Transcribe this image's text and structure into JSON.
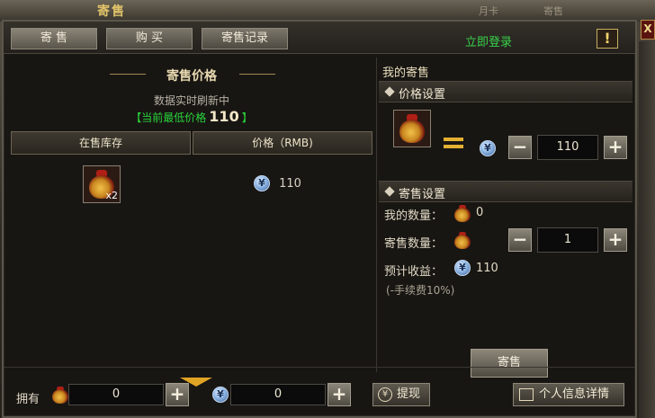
{
  "scene": {
    "title": "寄售",
    "bg_text_left": "月卡",
    "bg_text_right": "寄售"
  },
  "tabs": [
    {
      "label": "寄 售"
    },
    {
      "label": "购 买"
    },
    {
      "label": "寄售记录"
    }
  ],
  "header": {
    "login_link": "立即登录",
    "alert_icon": "!",
    "close_icon": "X"
  },
  "left": {
    "section_title": "寄售价格",
    "refresh_text": "数据实时刷新中",
    "lowest_prefix": "【当前最低价格",
    "lowest_value": "110",
    "lowest_suffix": "】",
    "columns": [
      "在售库存",
      "价格（RMB)"
    ],
    "rows": [
      {
        "item_icon": "lucky-bag-icon",
        "quantity": "x2",
        "price": "110"
      }
    ]
  },
  "right": {
    "title": "我的寄售",
    "price_settings": {
      "heading": "价格设置",
      "equals": "=",
      "value": "110",
      "minus": "−",
      "plus": "+"
    },
    "sale_settings": {
      "heading": "寄售设置",
      "my_quantity_label": "我的数量：",
      "my_quantity_value": "0",
      "sell_quantity_label": "寄售数量：",
      "sell_quantity_value": "1",
      "minus": "−",
      "plus": "+",
      "expected_label": "预计收益：",
      "expected_value": "110",
      "fee_note": "(-手续费10%)"
    },
    "sell_button": "寄售"
  },
  "bottom": {
    "own_label": "拥有",
    "bag_count": "0",
    "coin_count": "0",
    "plus": "+",
    "withdraw_button": "提现",
    "profile_button": "个人信息详情"
  },
  "coin_symbol": "¥",
  "colors": {
    "accent_green": "#29d43a",
    "gold": "#e4b032",
    "panel_bg": "#181613"
  }
}
